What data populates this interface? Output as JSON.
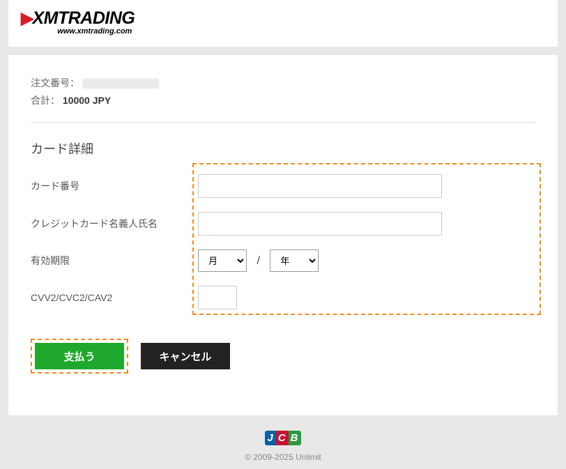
{
  "brand": {
    "name": "XMTRADING",
    "url": "www.xmtrading.com"
  },
  "summary": {
    "order_label": "注文番号：",
    "total_label": "合計：",
    "total_value": "10000 JPY"
  },
  "form": {
    "section_title": "カード詳細",
    "card_number_label": "カード番号",
    "card_holder_label": "クレジットカード名義人氏名",
    "expiry_label": "有効期限",
    "expiry_month_placeholder": "月",
    "expiry_year_placeholder": "年",
    "expiry_separator": "/",
    "cvv_label": "CVV2/CVC2/CAV2"
  },
  "buttons": {
    "pay": "支払う",
    "cancel": "キャンセル"
  },
  "footer": {
    "card_brand": "JCB",
    "copyright": "© 2009-2025 Unlimit"
  }
}
